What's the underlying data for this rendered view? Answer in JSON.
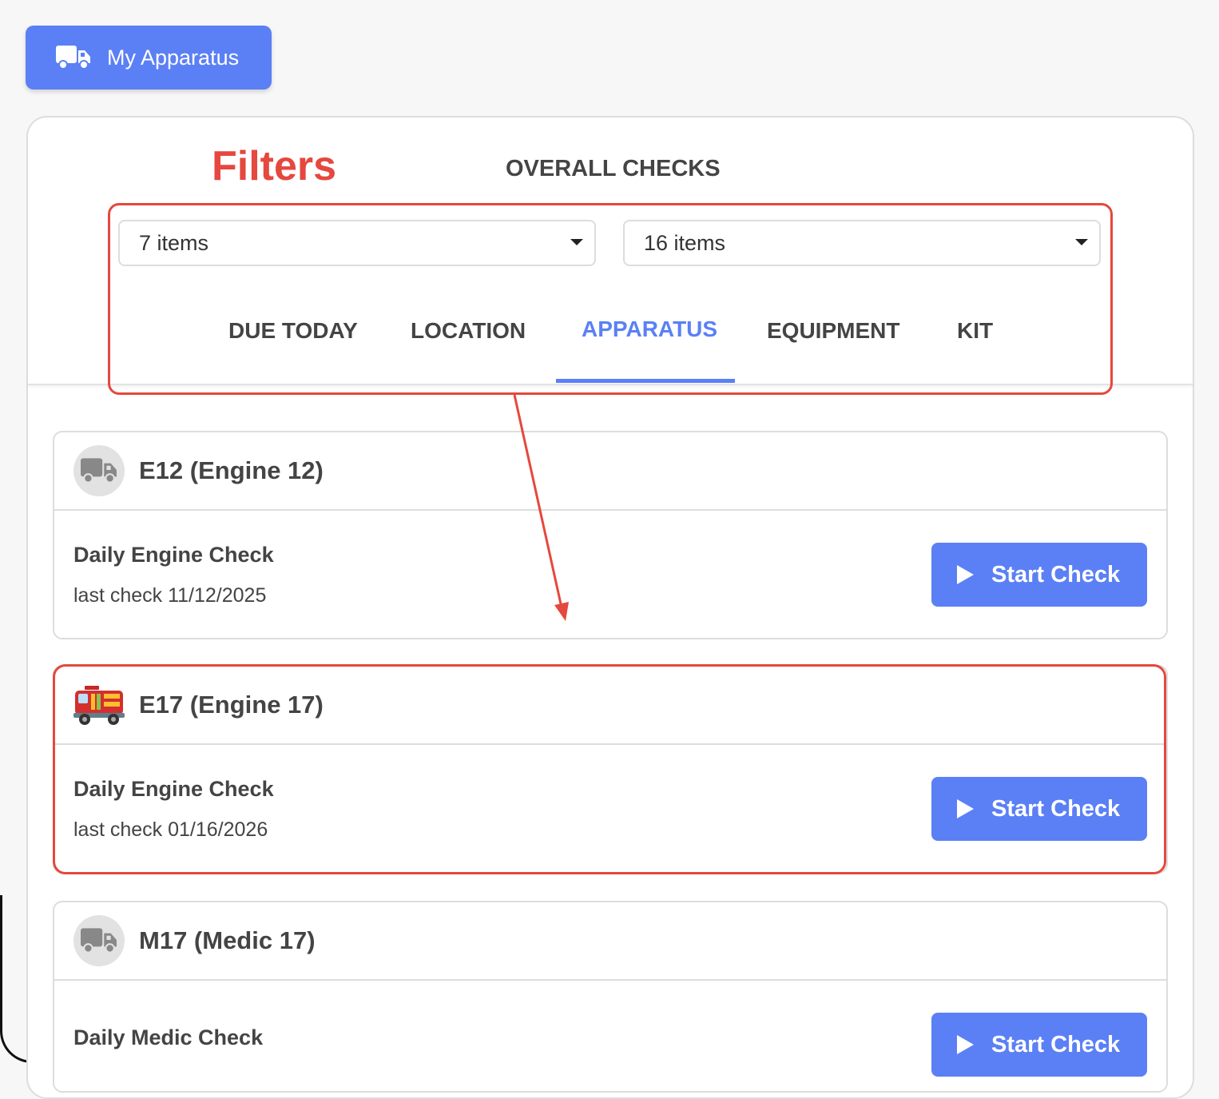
{
  "header": {
    "my_apparatus_label": "My Apparatus"
  },
  "annotations": {
    "filters_label": "Filters"
  },
  "panel": {
    "overall_checks_label": "OVERALL CHECKS",
    "select_1_value": "7 items",
    "select_2_value": "16 items",
    "tabs": [
      {
        "label": "DUE TODAY"
      },
      {
        "label": "LOCATION"
      },
      {
        "label": "APPARATUS"
      },
      {
        "label": "EQUIPMENT"
      },
      {
        "label": "KIT"
      }
    ],
    "active_tab": "APPARATUS"
  },
  "apparatus_list": [
    {
      "title": "E12 (Engine 12)",
      "icon": "truck-icon",
      "check_name": "Daily Engine Check",
      "last_check": "last check 11/12/2025",
      "button_label": "Start Check"
    },
    {
      "title": "E17 (Engine 17)",
      "icon": "fire-engine-icon",
      "check_name": "Daily Engine Check",
      "last_check": "last check 01/16/2026",
      "button_label": "Start Check"
    },
    {
      "title": "M17 (Medic 17)",
      "icon": "truck-icon",
      "check_name": "Daily Medic Check",
      "last_check": "",
      "button_label": "Start Check"
    }
  ],
  "colors": {
    "accent": "#5b80f5",
    "annotation": "#e5483e"
  }
}
